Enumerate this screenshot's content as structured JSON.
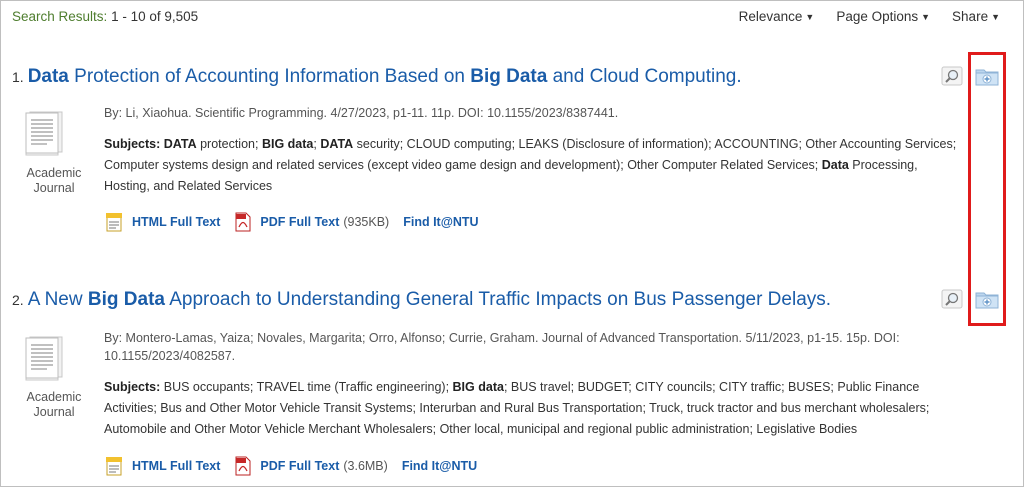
{
  "header": {
    "results_label": "Search Results:",
    "results_range": "1 - 10 of 9,505",
    "menu": [
      {
        "label": "Relevance"
      },
      {
        "label": "Page Options"
      },
      {
        "label": "Share"
      }
    ]
  },
  "results": [
    {
      "number": "1.",
      "title_parts": [
        {
          "text": "Data",
          "bold": true
        },
        {
          "text": " Protection of Accounting Information Based on ",
          "bold": false
        },
        {
          "text": "Big Data",
          "bold": true
        },
        {
          "text": " and Cloud Computing.",
          "bold": false
        }
      ],
      "doc_type": "Academic Journal",
      "meta": "By: Li, Xiaohua. Scientific Programming. 4/27/2023, p1-11. 11p. DOI: 10.1155/2023/8387441.",
      "subjects_label": "Subjects:",
      "subjects_parts": [
        {
          "text": " "
        },
        {
          "text": "DATA",
          "bold": true
        },
        {
          "text": " protection; "
        },
        {
          "text": "BIG data",
          "bold": true
        },
        {
          "text": "; "
        },
        {
          "text": "DATA",
          "bold": true
        },
        {
          "text": " security; CLOUD computing; LEAKS (Disclosure of information); ACCOUNTING; Other Accounting Services; Computer systems design and related services (except video game design and development); Other Computer Related Services; "
        },
        {
          "text": "Data",
          "bold": true
        },
        {
          "text": " Processing, Hosting, and Related Services"
        }
      ],
      "links": {
        "html": "HTML Full Text",
        "pdf": "PDF Full Text",
        "pdf_size": "(935KB)",
        "find": "Find It@NTU"
      }
    },
    {
      "number": "2.",
      "title_parts": [
        {
          "text": "A New ",
          "bold": false
        },
        {
          "text": "Big Data",
          "bold": true
        },
        {
          "text": " Approach to Understanding General Traffic Impacts on Bus Passenger Delays.",
          "bold": false
        }
      ],
      "doc_type": "Academic Journal",
      "meta": "By: Montero-Lamas, Yaiza; Novales, Margarita; Orro, Alfonso; Currie, Graham. Journal of Advanced Transportation. 5/11/2023, p1-15. 15p. DOI: 10.1155/2023/4082587.",
      "subjects_label": "Subjects:",
      "subjects_parts": [
        {
          "text": " BUS occupants; TRAVEL time (Traffic engineering); "
        },
        {
          "text": "BIG data",
          "bold": true
        },
        {
          "text": "; BUS travel; BUDGET; CITY councils; CITY traffic; BUSES; Public Finance Activities; Bus and Other Motor Vehicle Transit Systems; Interurban and Rural Bus Transportation; Truck, truck tractor and bus merchant wholesalers; Automobile and Other Motor Vehicle Merchant Wholesalers; Other local, municipal and regional public administration; Legislative Bodies"
        }
      ],
      "links": {
        "html": "HTML Full Text",
        "pdf": "PDF Full Text",
        "pdf_size": "(3.6MB)",
        "find": "Find It@NTU"
      }
    }
  ],
  "colors": {
    "link": "#1a5ca8",
    "count": "#4e7d2e",
    "highlight": "#e01b1b"
  }
}
